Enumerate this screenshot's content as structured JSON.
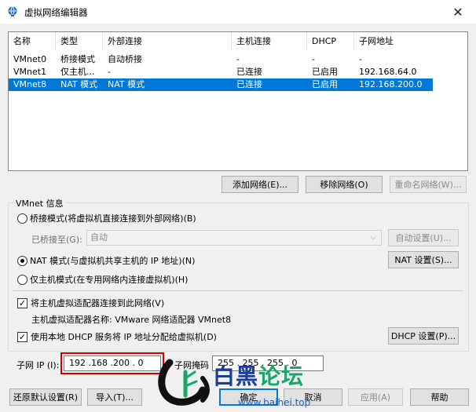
{
  "window": {
    "title": "虚拟网络编辑器",
    "close_glyph": "✕"
  },
  "table": {
    "headers": [
      "名称",
      "类型",
      "外部连接",
      "主机连接",
      "DHCP",
      "子网地址"
    ],
    "rows": [
      [
        "VMnet0",
        "桥接模式",
        "自动桥接",
        "-",
        "-",
        "-"
      ],
      [
        "VMnet1",
        "仅主机...",
        "-",
        "已连接",
        "已启用",
        "192.168.64.0"
      ],
      [
        "VMnet8",
        "NAT 模式",
        "NAT 模式",
        "已连接",
        "已启用",
        "192.168.200.0"
      ]
    ],
    "selected_row": 2,
    "selection_color": "#0078d7"
  },
  "table_buttons": {
    "add": "添加网络(E)...",
    "remove": "移除网络(O)",
    "rename": "重命名网络(W)..."
  },
  "vmnet_info": {
    "legend": "VMnet 信息",
    "bridged_label": "桥接模式(将虚拟机直接连接到外部网络)(B)",
    "bridged_to_label": "已桥接至(G):",
    "bridged_to_value": "自动",
    "auto_settings": "自动设置(U)...",
    "nat_label": "NAT 模式(与虚拟机共享主机的 IP 地址)(N)",
    "nat_settings": "NAT 设置(S)...",
    "hostonly_label": "仅主机模式(在专用网络内连接虚拟机)(H)",
    "selected_mode": "nat",
    "connect_adapter_label": "将主机虚拟适配器连接到此网络(V)",
    "connect_adapter_checked": true,
    "adapter_name": "主机虚拟适配器名称: VMware 网络适配器 VMnet8",
    "dhcp_label": "使用本地 DHCP 服务将 IP 地址分配给虚拟机(D)",
    "dhcp_checked": true,
    "dhcp_settings": "DHCP 设置(P)...",
    "subnet_ip_label": "子网 IP (I):",
    "subnet_ip_value": "192 .168 .200 . 0",
    "subnet_mask_label": "子网掩码",
    "subnet_mask_value": "255 . 255 . 255 . 0"
  },
  "bottom_buttons": {
    "restore": "还原默认设置(R)",
    "import": "导入(T)...",
    "ok": "确定",
    "cancel": "取消",
    "apply": "应用(A)",
    "help": "帮助"
  },
  "watermark": {
    "text_part1": "白黑",
    "text_part2": "论坛",
    "url": "www.baihei.top"
  },
  "icons": {
    "app": "network-globe-icon",
    "check": "✓",
    "dropdown": "chevron-down-icon"
  }
}
